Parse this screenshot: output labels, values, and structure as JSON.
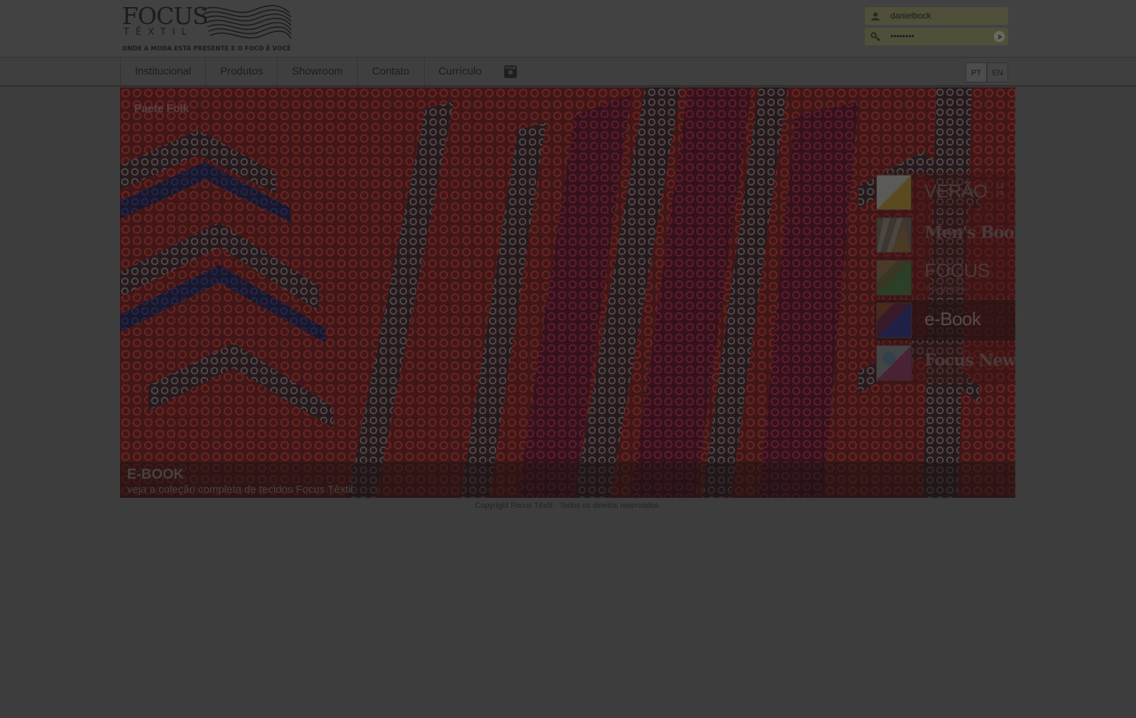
{
  "brand": {
    "logo_word": "FOCUS",
    "logo_sub": "TÊXTIL",
    "tagline": "ONDE A MODA ESTÁ PRESENTE E O FOCO É VOCÊ"
  },
  "login": {
    "username": "danielbock",
    "password_mask": "••••••••",
    "user_icon": "user-icon",
    "key_icon": "key-icon",
    "submit_icon": "play-arrow-icon"
  },
  "nav": {
    "items": [
      "Institucional",
      "Produtos",
      "Showroom",
      "Contato",
      "Currículo"
    ],
    "camera_icon": "instagram-camera-icon",
    "languages": [
      "PT",
      "EN"
    ],
    "active_language": "PT"
  },
  "hero": {
    "title": "Paete Folk",
    "side_menu": [
      {
        "label": "VERÃO",
        "sup_top": "13",
        "sup_bottom": "14"
      },
      {
        "label": "Men's Book"
      },
      {
        "label": "FOCUS",
        "sub": "on jeans"
      },
      {
        "label": "e-Book",
        "active": true
      },
      {
        "label": "Focus News"
      }
    ],
    "caption_title": "E-BOOK",
    "caption_sub": "veja a coleção completa de tecidos Focus Têxtil"
  },
  "footer": {
    "copyright": "Copyright Focus Têxtil - Todos os direitos reservados."
  },
  "colors": {
    "page_bg": "#3d3d3d",
    "overlay": "#424242",
    "login_field": "#4f4f3a"
  }
}
